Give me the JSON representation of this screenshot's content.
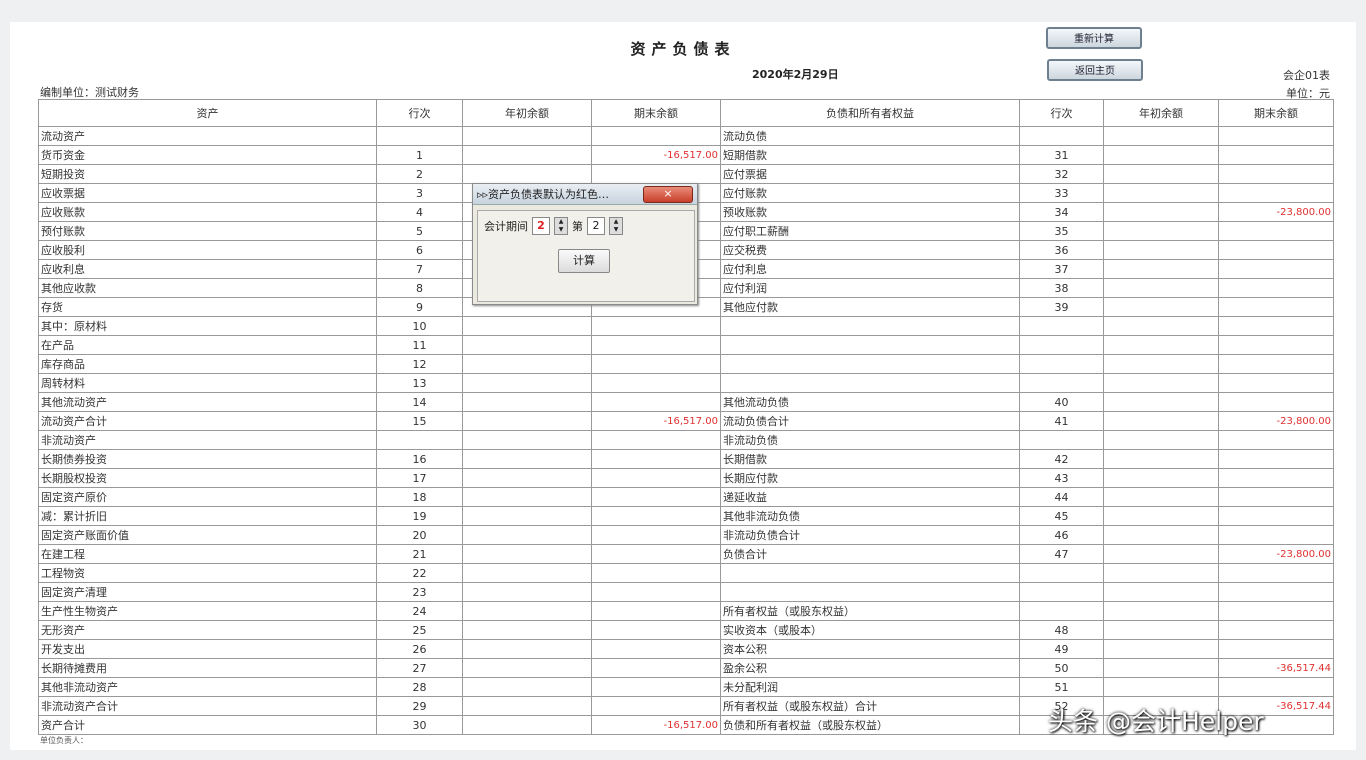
{
  "report": {
    "title": "资产负债表",
    "date": "2020年2月29日",
    "unit_left": "编制单位：测试财务",
    "form_code": "会企01表",
    "unit_right": "单位：元",
    "footer_note": "单位负责人："
  },
  "buttons": {
    "top1": "重新计算",
    "top2": "返回主页"
  },
  "headers": [
    "资产",
    "行次",
    "年初余额",
    "期末余额",
    "负债和所有者权益",
    "行次",
    "年初余额",
    "期末余额"
  ],
  "rows": [
    [
      "流动资产",
      "",
      "",
      "",
      "流动负债",
      "",
      "",
      ""
    ],
    [
      "货币资金",
      "1",
      "",
      "-16,517.00",
      "短期借款",
      "31",
      "",
      ""
    ],
    [
      "短期投资",
      "2",
      "",
      "",
      "应付票据",
      "32",
      "",
      ""
    ],
    [
      "应收票据",
      "3",
      "",
      "",
      "应付账款",
      "33",
      "",
      ""
    ],
    [
      "应收账款",
      "4",
      "",
      "",
      "预收账款",
      "34",
      "",
      "-23,800.00"
    ],
    [
      "预付账款",
      "5",
      "",
      "",
      "应付职工薪酬",
      "35",
      "",
      ""
    ],
    [
      "应收股利",
      "6",
      "",
      "",
      "应交税费",
      "36",
      "",
      ""
    ],
    [
      "应收利息",
      "7",
      "",
      "",
      "应付利息",
      "37",
      "",
      ""
    ],
    [
      "其他应收款",
      "8",
      "",
      "",
      "应付利润",
      "38",
      "",
      ""
    ],
    [
      "存货",
      "9",
      "",
      "",
      "其他应付款",
      "39",
      "",
      ""
    ],
    [
      "其中：原材料",
      "10",
      "",
      "",
      "",
      "",
      "",
      ""
    ],
    [
      "在产品",
      "11",
      "",
      "",
      "",
      "",
      "",
      ""
    ],
    [
      "库存商品",
      "12",
      "",
      "",
      "",
      "",
      "",
      ""
    ],
    [
      "周转材料",
      "13",
      "",
      "",
      "",
      "",
      "",
      ""
    ],
    [
      "其他流动资产",
      "14",
      "",
      "",
      "其他流动负债",
      "40",
      "",
      ""
    ],
    [
      "流动资产合计",
      "15",
      "",
      "-16,517.00",
      "流动负债合计",
      "41",
      "",
      "-23,800.00"
    ],
    [
      "非流动资产",
      "",
      "",
      "",
      "非流动负债",
      "",
      "",
      ""
    ],
    [
      "长期债券投资",
      "16",
      "",
      "",
      "长期借款",
      "42",
      "",
      ""
    ],
    [
      "长期股权投资",
      "17",
      "",
      "",
      "长期应付款",
      "43",
      "",
      ""
    ],
    [
      "固定资产原价",
      "18",
      "",
      "",
      "递延收益",
      "44",
      "",
      ""
    ],
    [
      "减：累计折旧",
      "19",
      "",
      "",
      "其他非流动负债",
      "45",
      "",
      ""
    ],
    [
      "固定资产账面价值",
      "20",
      "",
      "",
      "非流动负债合计",
      "46",
      "",
      ""
    ],
    [
      "在建工程",
      "21",
      "",
      "",
      "负债合计",
      "47",
      "",
      "-23,800.00"
    ],
    [
      "工程物资",
      "22",
      "",
      "",
      "",
      "",
      "",
      ""
    ],
    [
      "固定资产清理",
      "23",
      "",
      "",
      "",
      "",
      "",
      ""
    ],
    [
      "生产性生物资产",
      "24",
      "",
      "",
      "所有者权益（或股东权益）",
      "",
      "",
      ""
    ],
    [
      "无形资产",
      "25",
      "",
      "",
      "实收资本（或股本）",
      "48",
      "",
      ""
    ],
    [
      "开发支出",
      "26",
      "",
      "",
      "资本公积",
      "49",
      "",
      ""
    ],
    [
      "长期待摊费用",
      "27",
      "",
      "",
      "盈余公积",
      "50",
      "",
      "-36,517.44"
    ],
    [
      "其他非流动资产",
      "28",
      "",
      "",
      "未分配利润",
      "51",
      "",
      ""
    ],
    [
      "非流动资产合计",
      "29",
      "",
      "",
      "所有者权益（或股东权益）合计",
      "52",
      "",
      "-36,517.44"
    ],
    [
      "资产合计",
      "30",
      "",
      "-16,517.00",
      "负债和所有者权益（或股东权益）",
      "",
      "",
      ""
    ]
  ],
  "dialog": {
    "title": "资产负债表默认为红色…",
    "close": "×",
    "period_label": "会计期间",
    "period_value": "2",
    "period_prefix": "第",
    "period_value2": "2",
    "calc_button": "计算"
  },
  "watermark": "头条 @会计Helper",
  "colors": {
    "negative": "#e03030"
  }
}
